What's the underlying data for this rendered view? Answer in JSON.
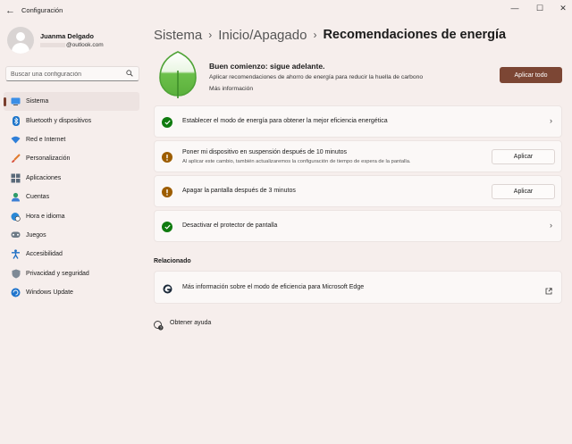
{
  "window": {
    "title": "Configuración"
  },
  "profile": {
    "name": "Juanma Delgado",
    "email": "@outlook.com"
  },
  "search": {
    "placeholder": "Buscar una configuración"
  },
  "nav": [
    {
      "label": "Sistema",
      "icon": "system-icon",
      "active": true
    },
    {
      "label": "Bluetooth y dispositivos",
      "icon": "bluetooth-icon"
    },
    {
      "label": "Red e Internet",
      "icon": "wifi-icon"
    },
    {
      "label": "Personalización",
      "icon": "brush-icon"
    },
    {
      "label": "Aplicaciones",
      "icon": "apps-icon"
    },
    {
      "label": "Cuentas",
      "icon": "accounts-icon"
    },
    {
      "label": "Hora e idioma",
      "icon": "globe-clock-icon"
    },
    {
      "label": "Juegos",
      "icon": "gamepad-icon"
    },
    {
      "label": "Accesibilidad",
      "icon": "accessibility-icon"
    },
    {
      "label": "Privacidad y seguridad",
      "icon": "shield-icon"
    },
    {
      "label": "Windows Update",
      "icon": "update-icon"
    }
  ],
  "breadcrumb": {
    "items": [
      "Sistema",
      "Inicio/Apagado"
    ],
    "current": "Recomendaciones de energía"
  },
  "hero": {
    "title": "Buen comienzo: sigue adelante.",
    "subtitle": "Aplicar recomendaciones de ahorro de energía para reducir la huella de carbono",
    "link": "Más información",
    "apply_all": "Aplicar todo"
  },
  "recommendations": [
    {
      "title": "Establecer el modo de energía para obtener la mejor eficiencia energética",
      "status": "ok"
    },
    {
      "title": "Poner mi dispositivo en suspensión después de 10 minutos",
      "subtitle": "Al aplicar este cambio, también actualizaremos la configuración de tiempo de espera de la pantalla.",
      "status": "pending",
      "action": "Aplicar"
    },
    {
      "title": "Apagar la pantalla después de 3 minutos",
      "status": "pending",
      "action": "Aplicar"
    },
    {
      "title": "Desactivar el protector de pantalla",
      "status": "ok"
    }
  ],
  "related": {
    "heading": "Relacionado",
    "items": [
      {
        "title": "Más información sobre el modo de eficiencia para Microsoft Edge"
      }
    ]
  },
  "help": {
    "label": "Obtener ayuda"
  },
  "colors": {
    "accent": "#7c4634",
    "ok": "#0f7b0f",
    "warn": "#9d5d00",
    "leaf": "#6cc04a"
  }
}
